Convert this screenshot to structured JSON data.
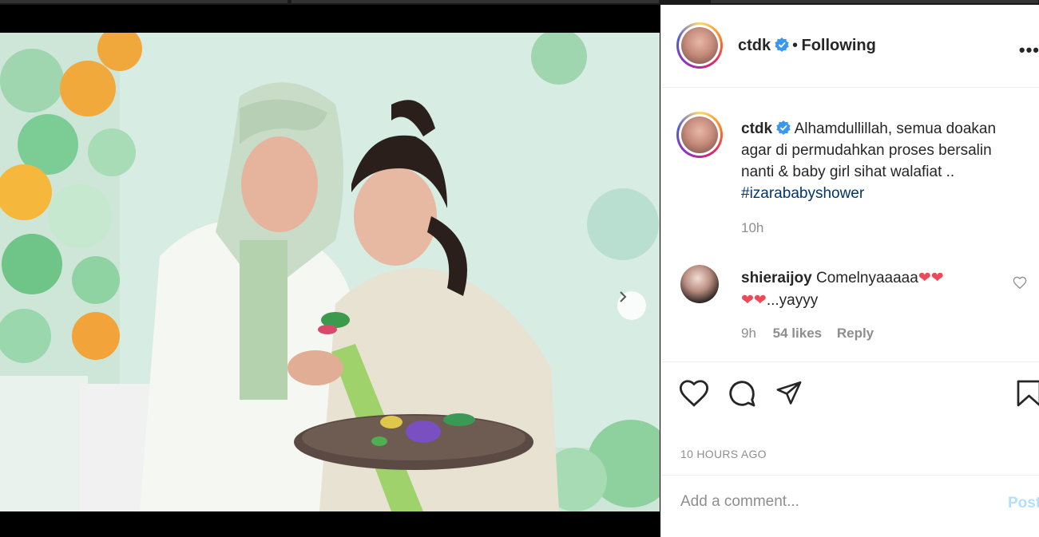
{
  "post": {
    "photo_alt": "",
    "carousel": {
      "count": 6,
      "active_index": 1
    }
  },
  "header": {
    "username": "ctdk",
    "separator": "•",
    "follow_state": "Following",
    "more_icon": "more-horizontal-icon"
  },
  "caption": {
    "username": "ctdk",
    "text": "Alhamdullillah, semua doakan agar di permudahkan proses bersalin nanti & baby girl sihat walafiat ..",
    "hashtag": "#izarababyshower",
    "time": "10h"
  },
  "comment": {
    "username": "shieraijoy",
    "text_line1": "Comelnyaaaaa",
    "hearts_line1": "❤❤",
    "hearts_line2": "❤❤",
    "text_line2": "...yayyy",
    "time": "9h",
    "likes": "54 likes",
    "reply": "Reply"
  },
  "actions": {
    "like_icon": "heart-icon",
    "comment_icon": "comment-icon",
    "share_icon": "share-icon",
    "save_icon": "bookmark-icon"
  },
  "timestamp": "10 HOURS AGO",
  "add_comment": {
    "placeholder": "Add a comment...",
    "post_label": "Post"
  },
  "colors": {
    "verified": "#3897f0",
    "link": "#00376b",
    "muted": "#8e8e8e",
    "heart_red": "#ed4956",
    "post_disabled": "#b2dffc"
  }
}
